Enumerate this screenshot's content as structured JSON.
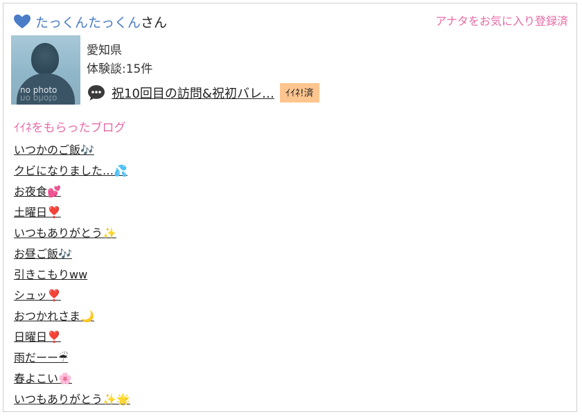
{
  "header": {
    "heart_icon": "blue-heart-icon",
    "username": "たっくんたっくん",
    "suffix": "さん",
    "favorite_status": "アナタをお気に入り登録済"
  },
  "profile": {
    "avatar_text": "no photo",
    "prefecture": "愛知県",
    "experience_count": "体験談:15件"
  },
  "message": {
    "icon": "speech-bubble-icon",
    "text": "祝10回目の訪問&祝初バレ…",
    "badge": "ｲｲﾈ!済"
  },
  "section_title": "ｲｲﾈをもらったブログ",
  "blogs": [
    "いつかのご飯🎶",
    "クビになりました…💦",
    "お夜食💕",
    "土曜日❣️",
    "いつもありがとう✨",
    "お昼ご飯🎶",
    "引きこもりww",
    "シュッ❣️",
    "おつかれさま🌙",
    "日曜日❣️",
    "雨だーー☔",
    "春よこい🌸",
    "いつもありがとう✨🌟"
  ],
  "colors": {
    "username": "#4a7cc8",
    "accent_pink": "#e86aa6",
    "badge_bg": "#ffc58f"
  }
}
